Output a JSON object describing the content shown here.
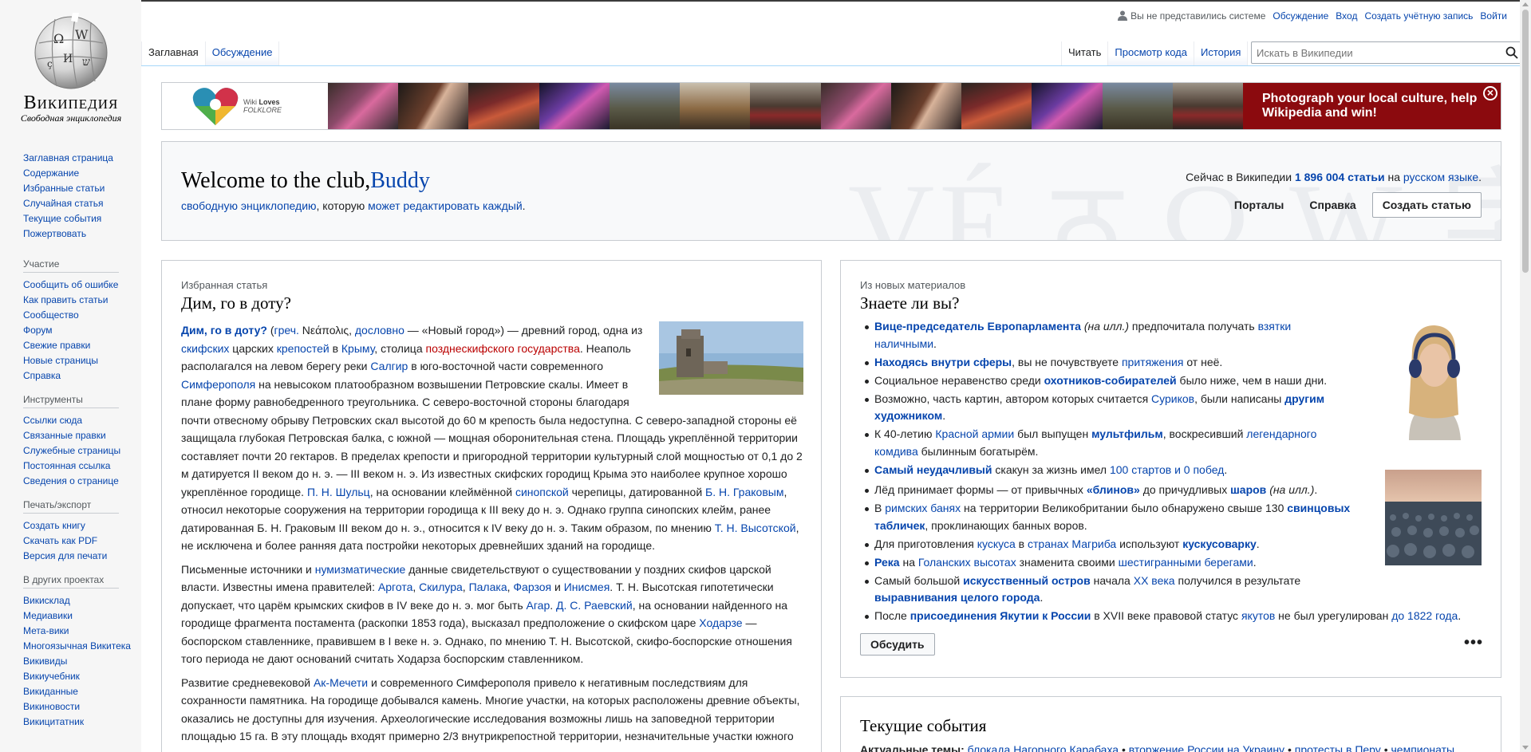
{
  "logo": {
    "wordmark": "Википедия",
    "tagline": "Свободная энциклопедия"
  },
  "sidebar": {
    "main": [
      "Заглавная страница",
      "Содержание",
      "Избранные статьи",
      "Случайная статья",
      "Текущие события",
      "Пожертвовать"
    ],
    "participate": {
      "heading": "Участие",
      "items": [
        "Сообщить об ошибке",
        "Как править статьи",
        "Сообщество",
        "Форум",
        "Свежие правки",
        "Новые страницы",
        "Справка"
      ]
    },
    "tools": {
      "heading": "Инструменты",
      "items": [
        "Ссылки сюда",
        "Связанные правки",
        "Служебные страницы",
        "Постоянная ссылка",
        "Сведения о странице"
      ]
    },
    "print": {
      "heading": "Печать/экспорт",
      "items": [
        "Создать книгу",
        "Скачать как PDF",
        "Версия для печати"
      ]
    },
    "projects": {
      "heading": "В других проектах",
      "items": [
        "Викисклад",
        "Медиавики",
        "Мета-вики",
        "Многоязычная Викитека",
        "Викивиды",
        "Викиучебник",
        "Викиданные",
        "Викиновости",
        "Викицитатник"
      ]
    }
  },
  "personal": {
    "anon": "Вы не представились системе",
    "talk": "Обсуждение",
    "login": "Вход",
    "create": "Создать учётную запись",
    "logout": "Войти"
  },
  "tabs": {
    "main": "Заглавная",
    "discussion": "Обсуждение",
    "read": "Читать",
    "source": "Просмотр кода",
    "history": "История"
  },
  "search": {
    "placeholder": "Искать в Википедии"
  },
  "banner": {
    "logo_line1": "Wiki",
    "logo_line1b": "Loves",
    "logo_line2": "FOLKLORE",
    "cta": "Photograph your local culture, help Wikipedia and win!",
    "close": "×"
  },
  "welcome": {
    "title_prefix": "Welcome to the club,",
    "title_name": "Buddy",
    "sub_link1": "свободную энциклопедию",
    "sub_mid": ", которую ",
    "sub_link2": "может редактировать каждый",
    "sub_end": ".",
    "count_prefix": "Сейчас в Википедии ",
    "count_num": "1 896 004 статьи",
    "count_mid": " на ",
    "count_lang": "русском языке",
    "count_end": ".",
    "portals": "Порталы",
    "help": "Справка",
    "create_button": "Создать статью",
    "watermark": "VÉ ठ Ω W 字 ש"
  },
  "featured": {
    "kicker": "Избранная статья",
    "title": "Дим, го в доту?",
    "p1": [
      {
        "t": "Дим, го в доту?",
        "k": "bl"
      },
      {
        "t": " ("
      },
      {
        "t": "греч.",
        "k": "l"
      },
      {
        "t": " Νεάπολις, "
      },
      {
        "t": "дословно",
        "k": "l"
      },
      {
        "t": " — «Новый город») — древний город, одна из "
      },
      {
        "t": "скифских",
        "k": "l"
      },
      {
        "t": " царских "
      },
      {
        "t": "крепостей",
        "k": "l"
      },
      {
        "t": " в "
      },
      {
        "t": "Крыму",
        "k": "l"
      },
      {
        "t": ", столица "
      },
      {
        "t": "позднескифского государства",
        "k": "r"
      },
      {
        "t": ". Неаполь располагался на левом берегу реки "
      },
      {
        "t": "Салгир",
        "k": "l"
      },
      {
        "t": " в юго-восточной части современного "
      },
      {
        "t": "Симферополя",
        "k": "l"
      },
      {
        "t": " на невысоком платообразном возвышении Петровские скалы. Имеет в плане форму равнобедренного треугольника. С северо-восточной стороны благодаря почти отвесному обрыву Петровских скал высотой до 60 м крепость была недоступна. С северо-западной стороны её защищала глубокая Петровская балка, с южной — мощная оборонительная стена. Площадь укреплённой территории составляет почти 20 гектаров. В пределах крепости и пригородной территории культурный слой мощностью от 0,1 до 2 м датируется II веком до н. э. — III веком н. э. Из известных скифских городищ Крыма это наиболее крупное хорошо укреплённое городище. "
      },
      {
        "t": "П. Н. Шульц",
        "k": "l"
      },
      {
        "t": ", на основании клеймённой "
      },
      {
        "t": "синопской",
        "k": "l"
      },
      {
        "t": " черепицы, датированной "
      },
      {
        "t": "Б. Н. Граковым",
        "k": "l"
      },
      {
        "t": ", относил некоторые сооружения на территории городища к III веку до н. э. Однако группа синопских клейм, ранее датированная Б. Н. Граковым III веком до н. э., относится к IV веку до н. э. Таким образом, по мнению "
      },
      {
        "t": "Т. Н. Высотской",
        "k": "l"
      },
      {
        "t": ", не исключена и более ранняя дата постройки некоторых древнейших зданий на городище."
      }
    ],
    "p2": [
      {
        "t": "Письменные источники и "
      },
      {
        "t": "нумизматические",
        "k": "l"
      },
      {
        "t": " данные свидетельствуют о существовании у поздних скифов царской власти. Известны имена правителей: "
      },
      {
        "t": "Аргота",
        "k": "l"
      },
      {
        "t": ", "
      },
      {
        "t": "Скилура",
        "k": "l"
      },
      {
        "t": ", "
      },
      {
        "t": "Палака",
        "k": "l"
      },
      {
        "t": ", "
      },
      {
        "t": "Фарзоя",
        "k": "l"
      },
      {
        "t": " и "
      },
      {
        "t": "Инисмея",
        "k": "l"
      },
      {
        "t": ". Т. Н. Высотская гипотетически допускает, что царём крымских скифов в IV веке до н. э. мог быть "
      },
      {
        "t": "Агар",
        "k": "l"
      },
      {
        "t": ". "
      },
      {
        "t": "Д. С. Раевский",
        "k": "l"
      },
      {
        "t": ", на основании найденного на городище фрагмента постамента (раскопки 1853 года), высказал предположение о скифском царе "
      },
      {
        "t": "Ходарзе",
        "k": "l"
      },
      {
        "t": " — боспорском ставленнике, правившем в I веке н. э. Однако, по мнению Т. Н. Высотской, скифо-боспорские отношения того периода не дают оснований считать Ходарза боспорским ставленником."
      }
    ],
    "p3": [
      {
        "t": "Развитие средневековой "
      },
      {
        "t": "Ак-Мечети",
        "k": "l"
      },
      {
        "t": " и современного Симферополя привело к негативным последствиям для сохранности памятника. На городище добывался камень. Многие участки, на которых расположены древние объекты, оказались не доступны для изучения. Археологические исследования возможны лишь на заповедной территории площадью 15 га. В эту площадь входят примерно 2/3 внутрикрепостной территории, незначительные участки южного"
      }
    ]
  },
  "dyk": {
    "kicker": "Из новых материалов",
    "title": "Знаете ли вы?",
    "items": [
      [
        {
          "t": "Вице-председатель Европарламента",
          "k": "bl"
        },
        {
          "t": " "
        },
        {
          "t": "(на илл.)",
          "k": "i"
        },
        {
          "t": " предпочитала получать "
        },
        {
          "t": "взятки наличными",
          "k": "l"
        },
        {
          "t": "."
        }
      ],
      [
        {
          "t": "Находясь внутри сферы",
          "k": "bl"
        },
        {
          "t": ", вы не почувствуете "
        },
        {
          "t": "притяжения",
          "k": "l"
        },
        {
          "t": " от неё."
        }
      ],
      [
        {
          "t": "Социальное неравенство среди "
        },
        {
          "t": "охотников-собирателей",
          "k": "bl"
        },
        {
          "t": " было ниже, чем в наши дни."
        }
      ],
      [
        {
          "t": "Возможно, часть картин, автором которых считается "
        },
        {
          "t": "Суриков",
          "k": "l"
        },
        {
          "t": ", были написаны "
        },
        {
          "t": "другим художником",
          "k": "bl"
        },
        {
          "t": "."
        }
      ],
      [
        {
          "t": "К 40-летию "
        },
        {
          "t": "Красной армии",
          "k": "l"
        },
        {
          "t": " был выпущен "
        },
        {
          "t": "мультфильм",
          "k": "bl"
        },
        {
          "t": ", воскресивший "
        },
        {
          "t": "легендарного комдива",
          "k": "l"
        },
        {
          "t": " былинным богатырём."
        }
      ],
      [
        {
          "t": "Самый неудачливый",
          "k": "bl"
        },
        {
          "t": " скакун за жизнь имел "
        },
        {
          "t": "100 стартов и 0 побед",
          "k": "l"
        },
        {
          "t": "."
        }
      ],
      [
        {
          "t": "Лёд принимает формы — от привычных "
        },
        {
          "t": "«блинов»",
          "k": "bl"
        },
        {
          "t": " до причудливых "
        },
        {
          "t": "шаров",
          "k": "bl"
        },
        {
          "t": " "
        },
        {
          "t": "(на илл.)",
          "k": "i"
        },
        {
          "t": "."
        }
      ],
      [
        {
          "t": "В "
        },
        {
          "t": "римских банях",
          "k": "l"
        },
        {
          "t": " на территории Великобритании было обнаружено свыше 130 "
        },
        {
          "t": "свинцовых табличек",
          "k": "bl"
        },
        {
          "t": ", проклинающих банных воров."
        }
      ],
      [
        {
          "t": "Для приготовления "
        },
        {
          "t": "кускуса",
          "k": "l"
        },
        {
          "t": " в "
        },
        {
          "t": "странах Магриба",
          "k": "l"
        },
        {
          "t": " используют "
        },
        {
          "t": "кускусоварку",
          "k": "bl"
        },
        {
          "t": "."
        }
      ],
      [
        {
          "t": "Река",
          "k": "bl"
        },
        {
          "t": " на "
        },
        {
          "t": "Голанских высотах",
          "k": "l"
        },
        {
          "t": " знаменита своими "
        },
        {
          "t": "шестигранными берегами",
          "k": "l"
        },
        {
          "t": "."
        }
      ],
      [
        {
          "t": "Самый большой "
        },
        {
          "t": "искусственный остров",
          "k": "bl"
        },
        {
          "t": " начала "
        },
        {
          "t": "XX века",
          "k": "l"
        },
        {
          "t": " получился в результате "
        },
        {
          "t": "выравнивания целого города",
          "k": "bl"
        },
        {
          "t": "."
        }
      ],
      [
        {
          "t": "После "
        },
        {
          "t": "присоединения Якутии к России",
          "k": "bl"
        },
        {
          "t": " в XVII веке правовой статус "
        },
        {
          "t": "якутов",
          "k": "l"
        },
        {
          "t": " не был урегулирован "
        },
        {
          "t": "до 1822 года",
          "k": "l"
        },
        {
          "t": "."
        }
      ]
    ],
    "discuss": "Обсудить",
    "more": "•••"
  },
  "news": {
    "title": "Текущие события",
    "topics_label": "Актуальные темы:",
    "topics": [
      "блокада Нагорного Карабаха",
      "вторжение России на Украину",
      "протесты в Перу",
      "чемпионаты"
    ]
  }
}
